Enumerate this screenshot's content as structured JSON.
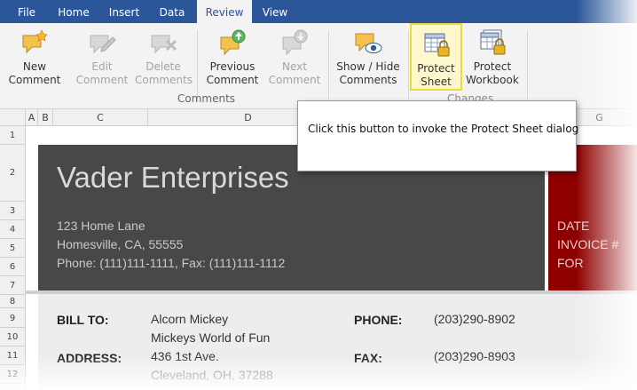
{
  "menu": {
    "tabs": [
      {
        "label": "File"
      },
      {
        "label": "Home"
      },
      {
        "label": "Insert"
      },
      {
        "label": "Data"
      },
      {
        "label": "Review"
      },
      {
        "label": "View"
      }
    ],
    "active_tab": "Review"
  },
  "ribbon": {
    "buttons": [
      {
        "line1": "New",
        "line2": "Comment",
        "icon": "new-comment-icon",
        "enabled": true
      },
      {
        "line1": "Edit",
        "line2": "Comment",
        "icon": "edit-comment-icon",
        "enabled": false
      },
      {
        "line1": "Delete",
        "line2": "Comments",
        "icon": "delete-comment-icon",
        "enabled": false
      },
      {
        "line1": "Previous",
        "line2": "Comment",
        "icon": "previous-comment-icon",
        "enabled": true
      },
      {
        "line1": "Next",
        "line2": "Comment",
        "icon": "next-comment-icon",
        "enabled": false
      },
      {
        "line1": "Show / Hide",
        "line2": "Comments",
        "icon": "show-hide-comments-icon",
        "enabled": true
      },
      {
        "line1": "Protect",
        "line2": "Sheet",
        "icon": "protect-sheet-icon",
        "enabled": true,
        "highlighted": true
      },
      {
        "line1": "Protect",
        "line2": "Workbook",
        "icon": "protect-workbook-icon",
        "enabled": true
      }
    ],
    "groups": {
      "comments": "Comments",
      "changes": "Changes"
    }
  },
  "sheet": {
    "columns": [
      "A",
      "B",
      "C",
      "D",
      "G"
    ],
    "rows": [
      "1",
      "2",
      "3",
      "4",
      "5",
      "6",
      "7",
      "8",
      "9",
      "10",
      "11",
      "12"
    ],
    "company": "Vader Enterprises",
    "address_line1": "123 Home Lane",
    "address_line2": "Homesville, CA, 55555",
    "phone_fax": "Phone: (111)111-1111, Fax: (111)111-1112",
    "right_labels": [
      "DATE",
      "INVOICE #",
      "FOR"
    ],
    "bill_to_label": "BILL TO:",
    "bill_to_name": "Alcorn Mickey",
    "bill_to_company": "Mickeys World of Fun",
    "address_label": "ADDRESS:",
    "address_street": "436 1st Ave.",
    "address_city": "Cleveland, OH, 37288",
    "phone_label": "PHONE:",
    "phone_value": "(203)290-8902",
    "fax_label": "FAX:",
    "fax_value": "(203)290-8903"
  },
  "callout": {
    "text": "Click this button to invoke the Protect Sheet dialog"
  },
  "colors": {
    "tabbar": "#2b579a",
    "ribbon": "#f3f3f3",
    "header_dark": "#484848",
    "header_red": "#8e0000",
    "highlight": "#ecdb3a"
  }
}
